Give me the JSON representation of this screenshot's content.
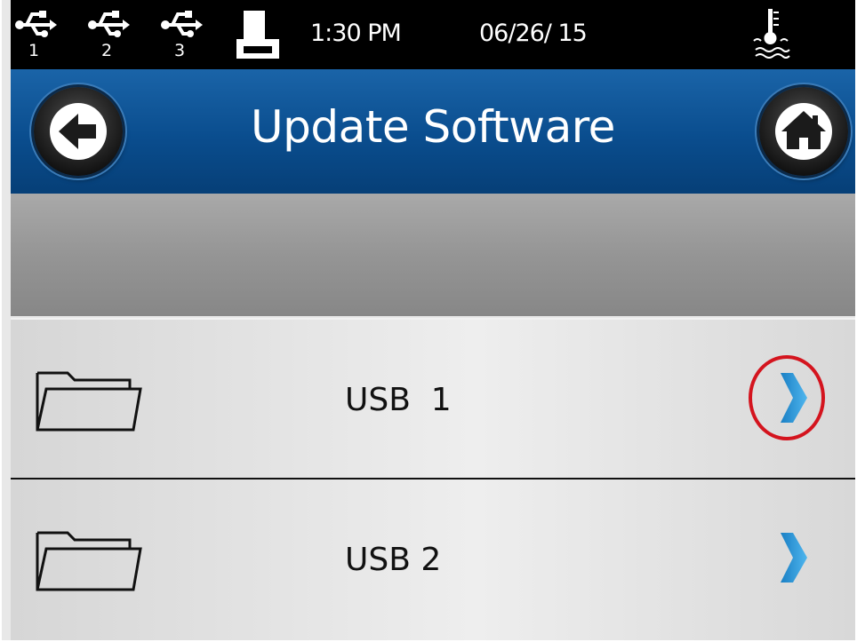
{
  "status_bar": {
    "usb_ports": [
      {
        "icon": "usb-icon",
        "number": "1"
      },
      {
        "icon": "usb-icon",
        "number": "2"
      },
      {
        "icon": "usb-icon",
        "number": "3"
      }
    ],
    "printer_icon": "printer-icon",
    "time": "1:30 PM",
    "date": "06/26/ 15",
    "temperature_icon": "temperature-icon"
  },
  "header": {
    "title": "Update Software",
    "back_icon": "back-arrow-icon",
    "home_icon": "home-icon"
  },
  "list": {
    "items": [
      {
        "label": "USB  1",
        "icon": "folder-icon",
        "chevron": "chevron-right-icon",
        "highlighted": true
      },
      {
        "label": "USB 2",
        "icon": "folder-icon",
        "chevron": "chevron-right-icon",
        "highlighted": false
      }
    ]
  },
  "colors": {
    "header_blue": "#0a4d8e",
    "chevron_blue": "#2a9ad8",
    "highlight_red": "#d4141e"
  }
}
